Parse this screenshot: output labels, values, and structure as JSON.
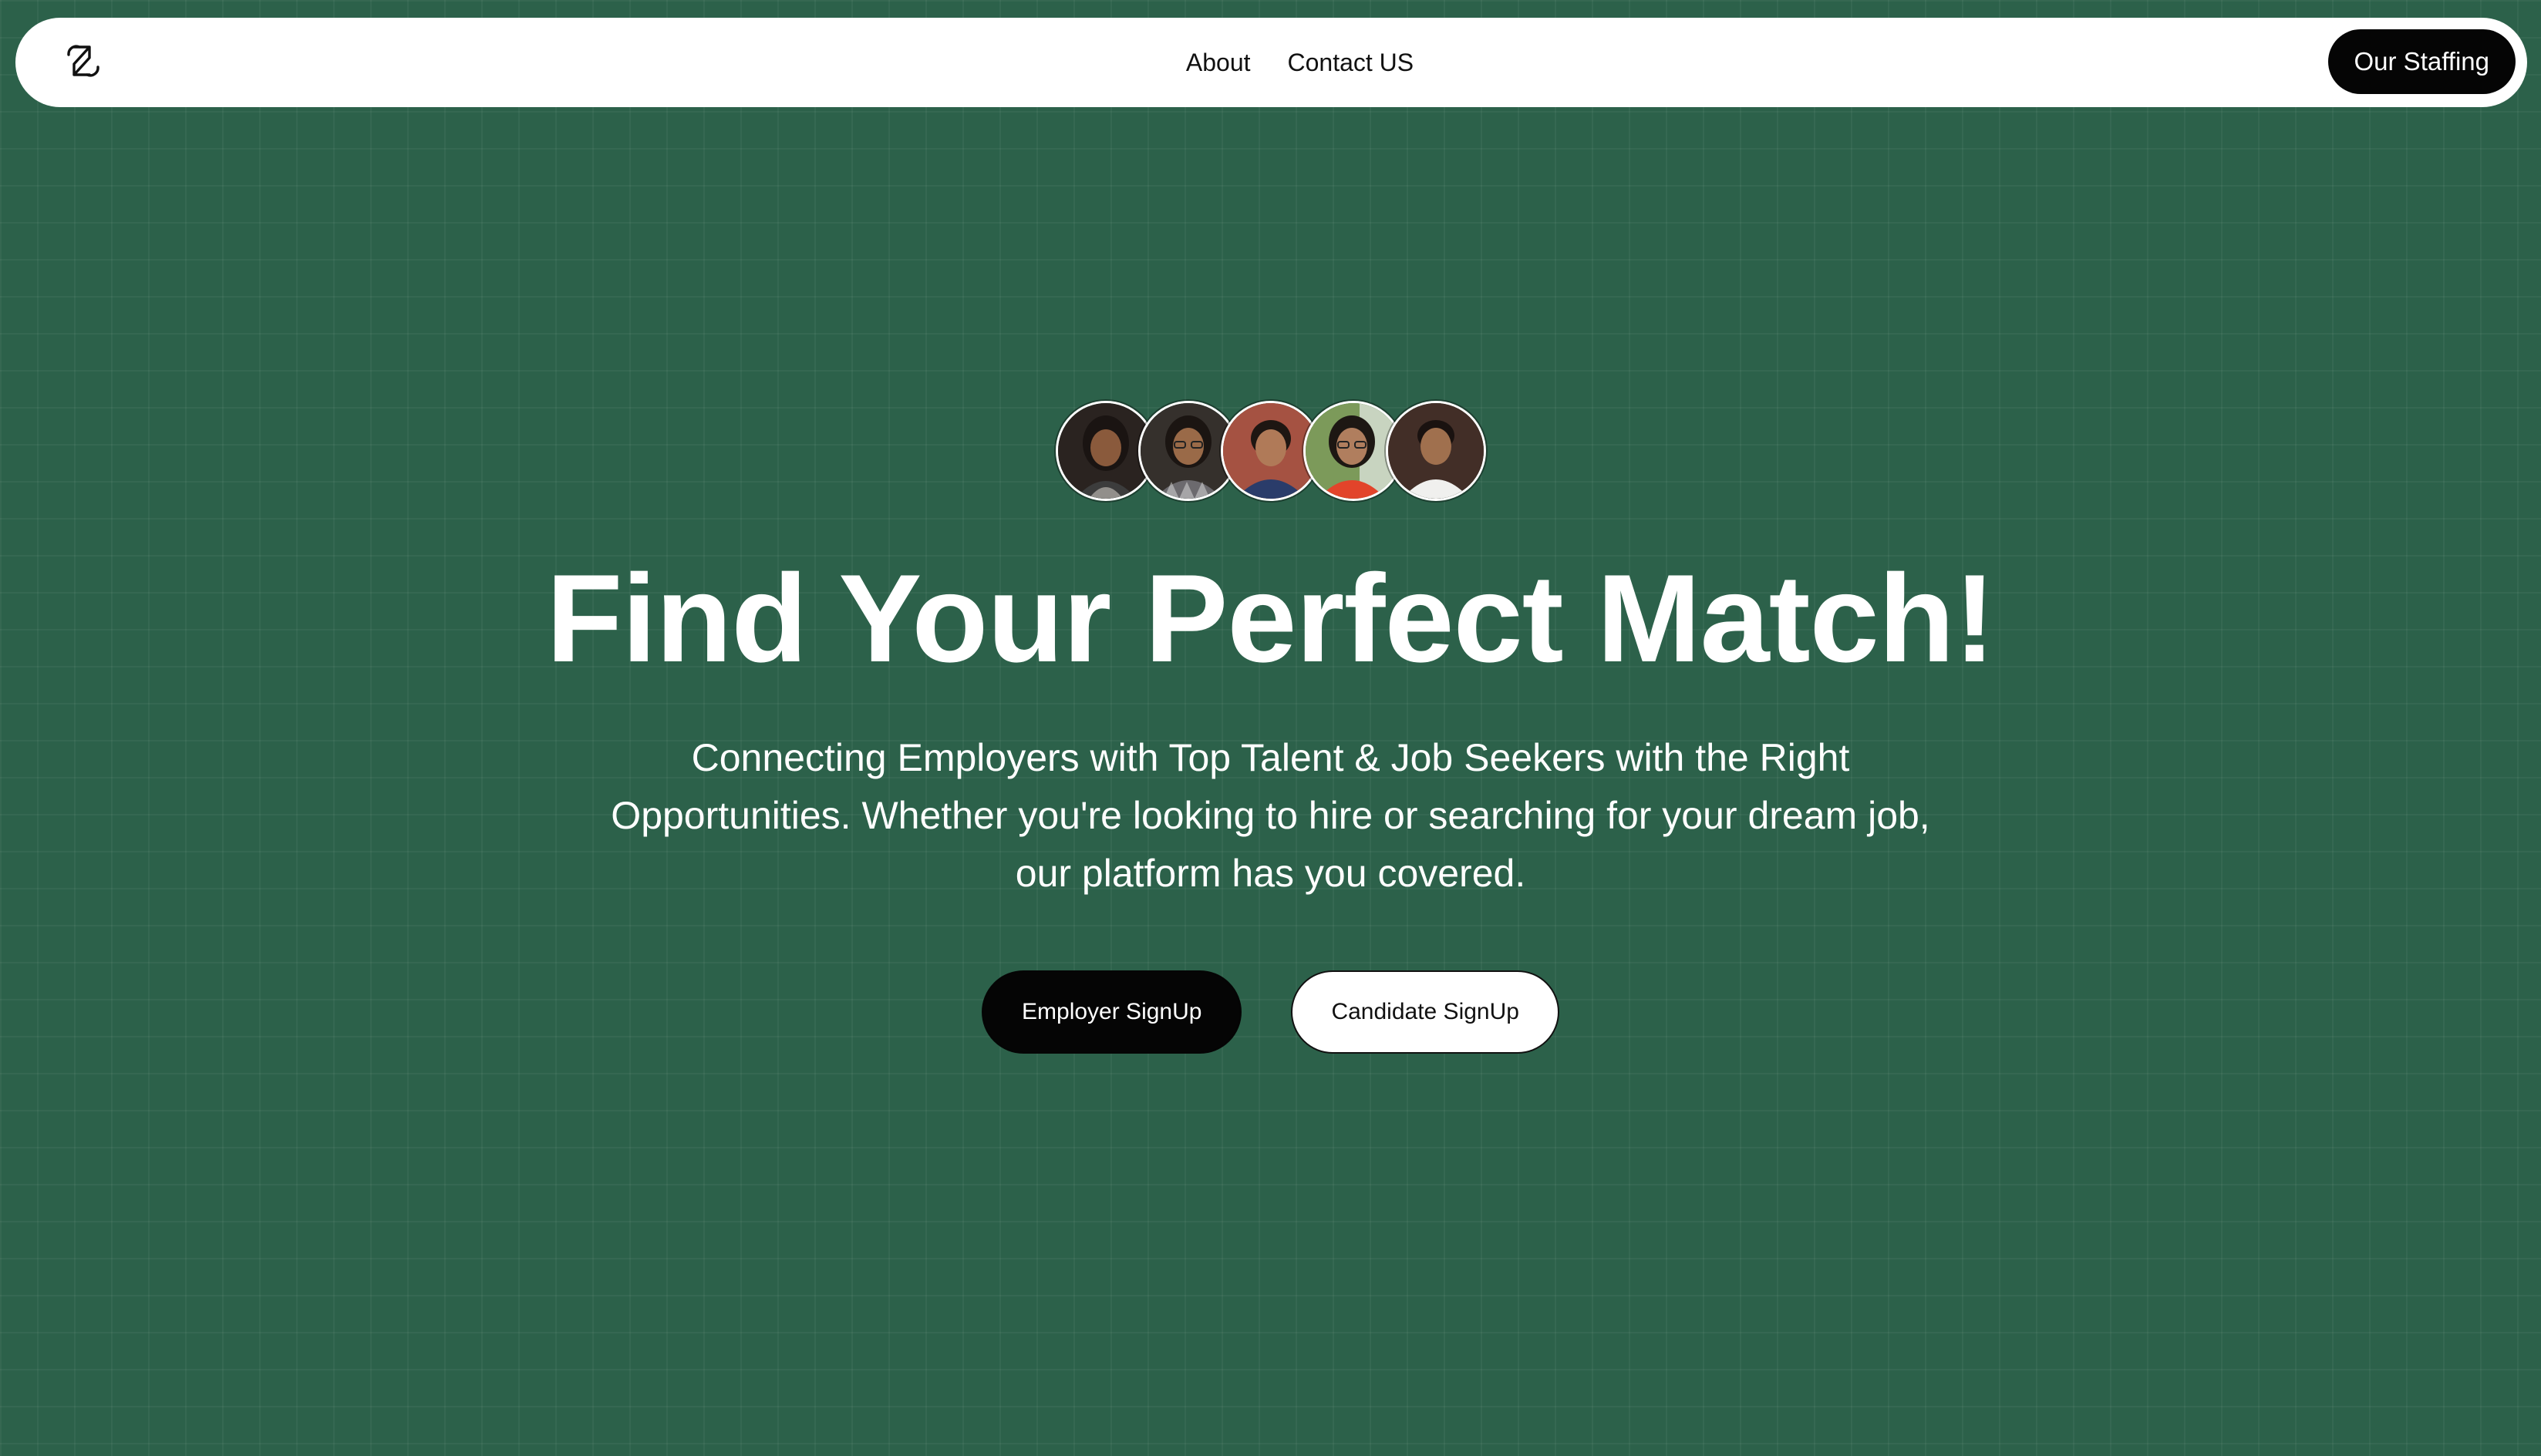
{
  "colors": {
    "background": "#2c614a",
    "navbar_bg": "#ffffff",
    "primary_button": "#050505",
    "text_light": "#ffffff",
    "text_dark": "#111111"
  },
  "navbar": {
    "logo_icon": "brand-logo-icon",
    "links": [
      {
        "label": "About"
      },
      {
        "label": "Contact US"
      }
    ],
    "cta_label": "Our Staffing"
  },
  "hero": {
    "avatars": [
      {
        "name": "avatar-1",
        "icon": "person-photo"
      },
      {
        "name": "avatar-2",
        "icon": "person-photo"
      },
      {
        "name": "avatar-3",
        "icon": "person-photo"
      },
      {
        "name": "avatar-4",
        "icon": "person-photo"
      },
      {
        "name": "avatar-5",
        "icon": "person-photo"
      }
    ],
    "title": "Find Your Perfect Match!",
    "subtitle": "Connecting Employers with Top Talent & Job Seekers with the Right Opportunities. Whether you're looking to hire or searching for your dream job, our platform has you covered.",
    "buttons": {
      "employer_label": "Employer SignUp",
      "candidate_label": "Candidate SignUp"
    }
  }
}
